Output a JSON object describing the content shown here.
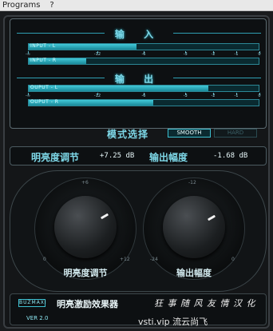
{
  "menu": {
    "programs": "Programs",
    "help": "?"
  },
  "input": {
    "heading": "输 入",
    "bars": [
      {
        "label": "INPUT - L",
        "level": 0.47
      },
      {
        "label": "INPUT - R",
        "level": 0.25
      }
    ],
    "scale": [
      "-∞",
      "-12",
      "-6",
      "-3",
      "-2",
      "-1",
      "0"
    ]
  },
  "output": {
    "heading": "输 出",
    "bars": [
      {
        "label": "OUPUT - L",
        "level": 0.78
      },
      {
        "label": "OUPUT - R",
        "level": 0.54
      }
    ],
    "scale": [
      "-∞",
      "-12",
      "-6",
      "-3",
      "-2",
      "-1",
      "0"
    ]
  },
  "mode": {
    "label": "模式选择",
    "smooth": "SMOOTH",
    "hard": "HARD"
  },
  "readout": {
    "brightness_label": "明亮度调节",
    "brightness_value": "+7.25 dB",
    "output_label": "输出幅度",
    "output_value": "-1.68 dB"
  },
  "knobs": {
    "brightness": {
      "label": "明亮度调节",
      "min": "0",
      "max": "+12",
      "top": "+6"
    },
    "output": {
      "label": "输出幅度",
      "min": "-24",
      "max": "0",
      "top": "-12"
    }
  },
  "footer": {
    "logo": "BUZMAXI",
    "title": "明亮激励效果器",
    "credit": "狂 事 随 风  友 情 汉 化",
    "version": "VER 2.0",
    "watermark": "vsti.vip 流云尚飞"
  },
  "colors": {
    "accent": "#42c9d8",
    "panel": "#141618"
  }
}
